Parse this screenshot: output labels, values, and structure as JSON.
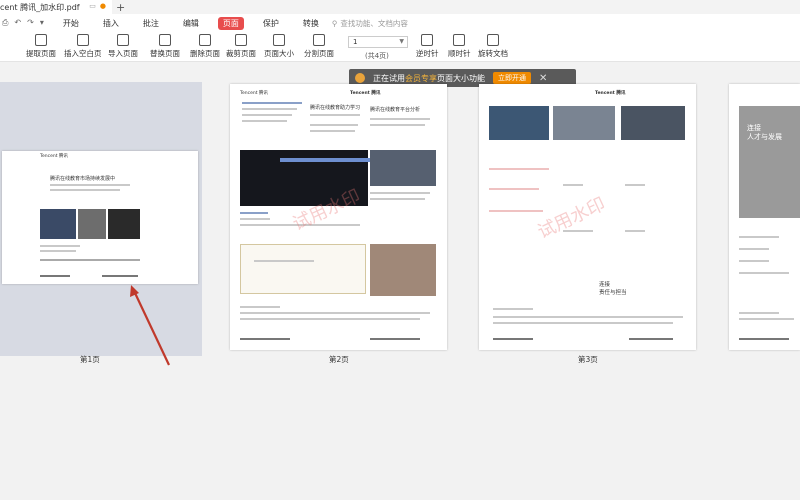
{
  "window": {
    "tab_title": "cent 腾讯_加水印.pdf",
    "new_tab": "+"
  },
  "menubar": {
    "items": [
      "开始",
      "插入",
      "批注",
      "编辑",
      "页面",
      "保护",
      "转换"
    ],
    "active_index": 4,
    "search_placeholder": "查找功能、文档内容"
  },
  "toolbar": {
    "tools": [
      "提取页面",
      "插入空白页",
      "导入页面",
      "替换页面",
      "删除页面",
      "裁剪页面",
      "页面大小",
      "分割页面",
      "逆时针",
      "顺时针",
      "旋转文档"
    ],
    "page_input": "1",
    "page_total": "(共4页)"
  },
  "notice": {
    "text_before": "正在试用",
    "text_highlight": "会员专享",
    "text_after": "页面大小功能",
    "button": "立即开通",
    "close": "✕"
  },
  "pages": {
    "labels": [
      "第1页",
      "第2页",
      "第3页"
    ],
    "watermark": "试用水印",
    "p1_heading": "腾讯在线教育市场持续发展中",
    "p2_heading_a": "腾讯在线教育助力学习",
    "p2_heading_b": "腾讯在线教育平台分析",
    "p3_slogan": "连接\n责任与担当",
    "p4_title": "连接\n人才与发展"
  },
  "colors": {
    "accent": "#e84d4d",
    "notice_bg": "#5a5a5a",
    "notice_btn": "#f08a00",
    "selection": "#d7dae3",
    "arrow": "#c0392b"
  }
}
